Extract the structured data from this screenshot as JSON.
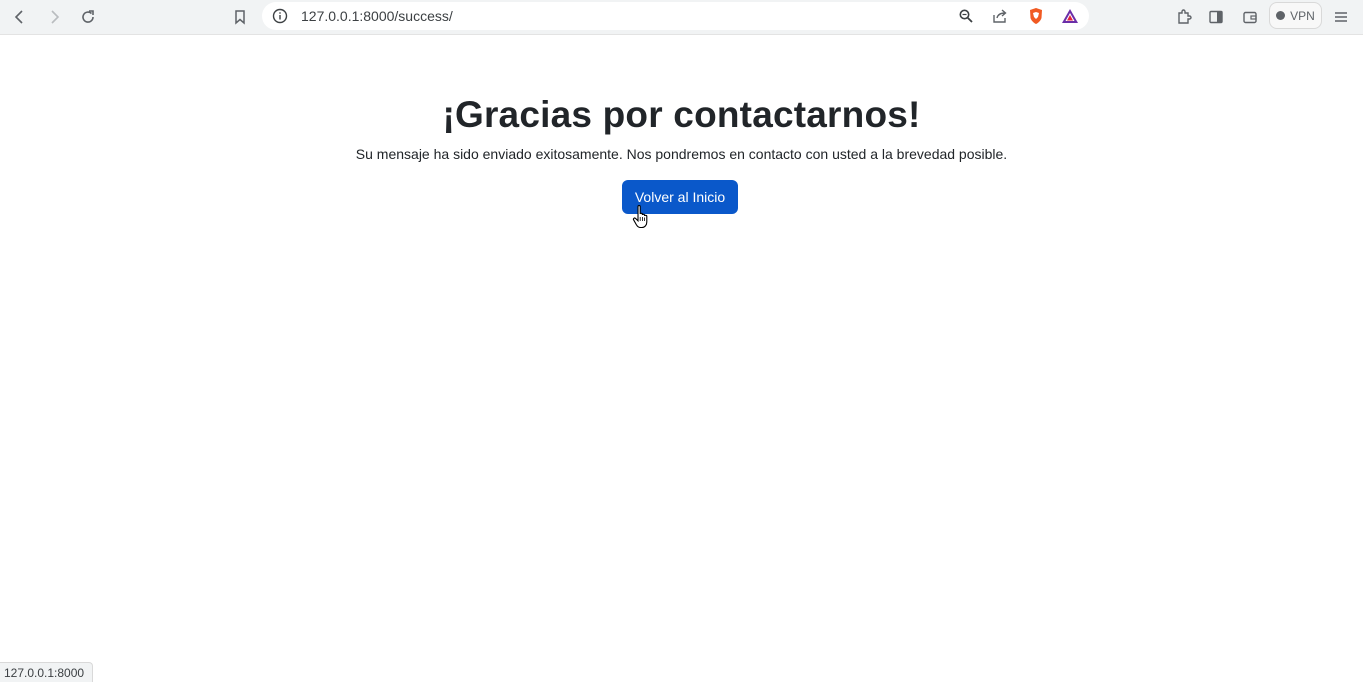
{
  "browser": {
    "url": "127.0.0.1:8000/success/",
    "vpn_label": "VPN",
    "status_url": "127.0.0.1:8000",
    "icons": [
      "back-icon",
      "forward-icon",
      "reload-icon",
      "bookmark-icon",
      "info-icon",
      "zoom-icon",
      "share-icon",
      "brave-shields-icon",
      "brave-rewards-icon",
      "extensions-icon",
      "sidebar-icon",
      "wallet-icon",
      "menu-icon"
    ]
  },
  "page": {
    "heading": "¡Gracias por contactarnos!",
    "message": "Su mensaje ha sido enviado exitosamente. Nos pondremos en contacto con usted a la brevedad posible.",
    "button_label": "Volver al Inicio",
    "button_color": "#0a58ca"
  }
}
